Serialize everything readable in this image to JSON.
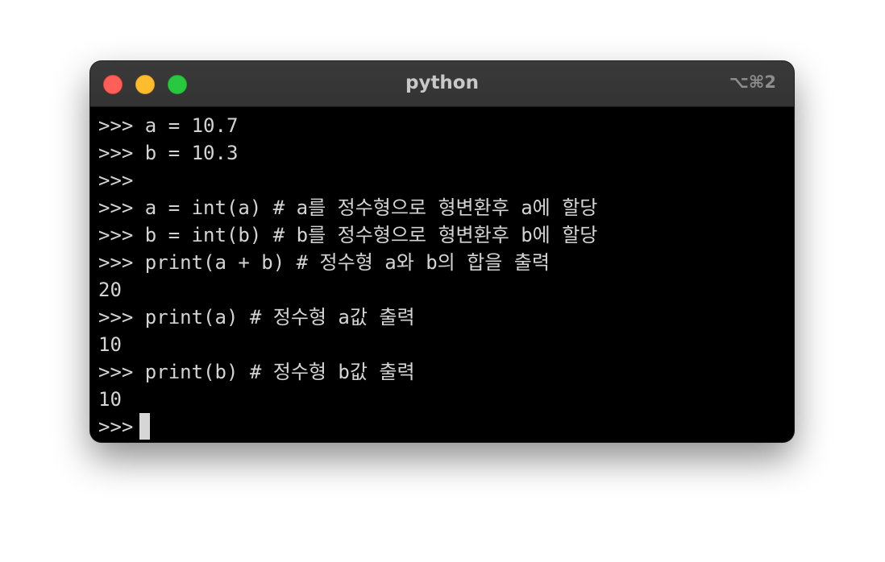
{
  "window": {
    "title": "python",
    "shortcut": "⌥⌘2"
  },
  "terminal": {
    "lines": [
      {
        "prompt": ">>> ",
        "text": "a = 10.7"
      },
      {
        "prompt": ">>> ",
        "text": "b = 10.3"
      },
      {
        "prompt": ">>>",
        "text": ""
      },
      {
        "prompt": ">>> ",
        "text": "a = int(a) # a를 정수형으로 형변환후 a에 할당"
      },
      {
        "prompt": ">>> ",
        "text": "b = int(b) # b를 정수형으로 형변환후 b에 할당"
      },
      {
        "prompt": ">>> ",
        "text": "print(a + b) # 정수형 a와 b의 합을 출력"
      },
      {
        "prompt": "",
        "text": "20"
      },
      {
        "prompt": ">>> ",
        "text": "print(a) # 정수형 a값 출력"
      },
      {
        "prompt": "",
        "text": "10"
      },
      {
        "prompt": ">>> ",
        "text": "print(b) # 정수형 b값 출력"
      },
      {
        "prompt": "",
        "text": "10"
      },
      {
        "prompt": ">>>",
        "text": ""
      }
    ]
  },
  "colors": {
    "close": "#fe5f57",
    "minimize": "#febc2e",
    "zoom": "#28c840",
    "background": "#000000",
    "foreground": "#d4d4d4"
  }
}
